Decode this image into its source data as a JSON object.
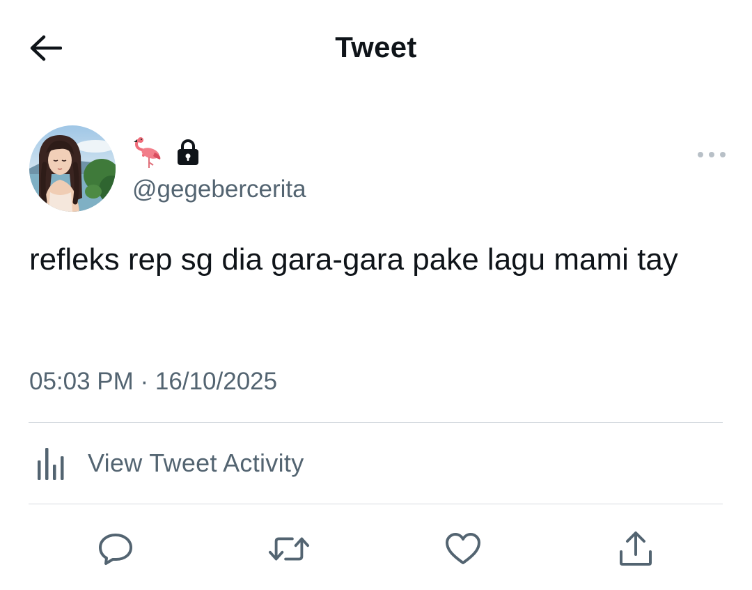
{
  "header": {
    "title": "Tweet"
  },
  "author": {
    "handle": "@gegebercerita",
    "name_icons": [
      "flamingo-emoji",
      "lock-icon"
    ],
    "avatar": "profile-photo"
  },
  "tweet": {
    "text": "refleks rep sg dia gara-gara pake lagu mami tay",
    "timestamp": "05:03 PM · 16/10/2025"
  },
  "activity": {
    "label": "View Tweet Activity",
    "icon": "bar-chart-icon"
  },
  "actions": [
    {
      "name": "reply",
      "icon": "comment-icon"
    },
    {
      "name": "retweet",
      "icon": "retweet-icon"
    },
    {
      "name": "like",
      "icon": "heart-icon"
    },
    {
      "name": "share",
      "icon": "share-icon"
    }
  ],
  "colors": {
    "text_primary": "#0f1419",
    "text_secondary": "#536471",
    "divider": "#d5dbe0",
    "icon": "#536471"
  }
}
